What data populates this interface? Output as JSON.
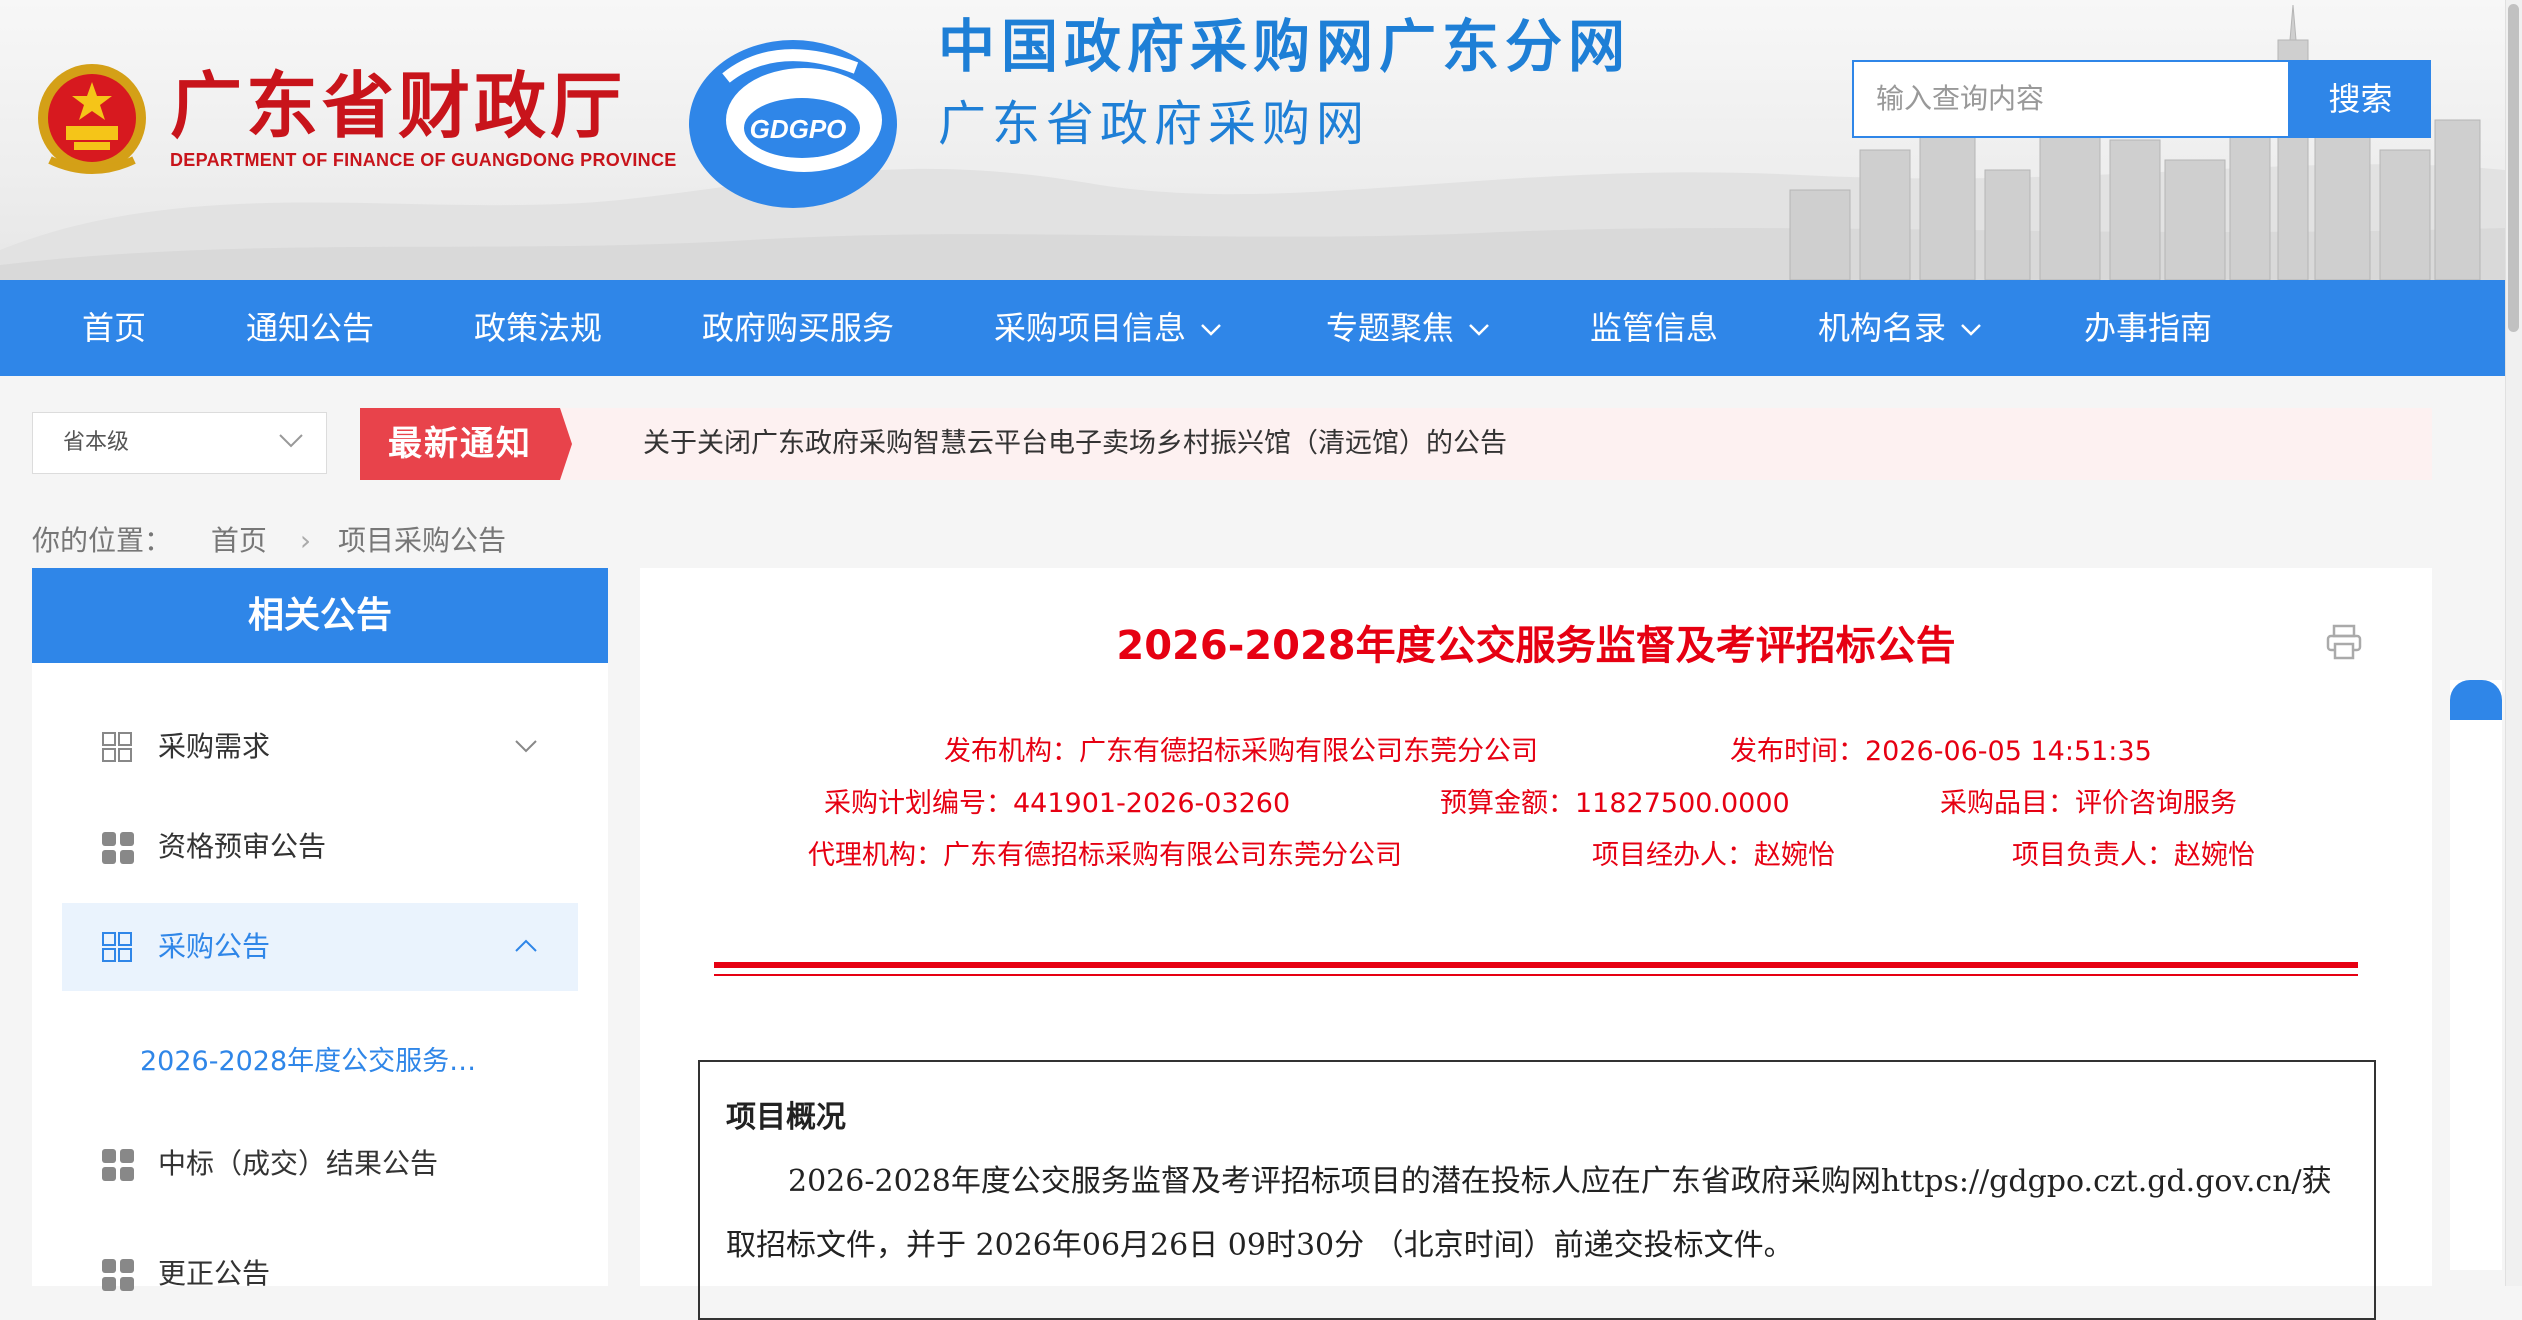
{
  "header": {
    "dept_cn": "广东省财政厅",
    "dept_en": "DEPARTMENT OF FINANCE OF GUANGDONG PROVINCE",
    "logo_text": "GDGPO",
    "site_title_1": "中国政府采购网广东分网",
    "site_title_2": "广东省政府采购网",
    "search_placeholder": "输入查询内容",
    "search_button": "搜索"
  },
  "nav": {
    "items": [
      {
        "label": "首页"
      },
      {
        "label": "通知公告"
      },
      {
        "label": "政策法规"
      },
      {
        "label": "政府购买服务"
      },
      {
        "label": "采购项目信息"
      },
      {
        "label": "专题聚焦"
      },
      {
        "label": "监管信息"
      },
      {
        "label": "机构名录"
      },
      {
        "label": "办事指南"
      }
    ]
  },
  "notice": {
    "level_select": "省本级",
    "tag": "最新通知",
    "text": "关于关闭广东政府采购智慧云平台电子卖场乡村振兴馆（清远馆）的公告"
  },
  "breadcrumb": {
    "prefix": "你的位置：",
    "home": "首页",
    "current": "项目采购公告"
  },
  "sidebar": {
    "title": "相关公告",
    "items": [
      {
        "label": "采购需求"
      },
      {
        "label": "资格预审公告"
      },
      {
        "label": "采购公告"
      },
      {
        "label": "中标（成交）结果公告"
      },
      {
        "label": "更正公告"
      }
    ],
    "active_sub": "2026-2028年度公交服务…"
  },
  "article": {
    "title": "2026-2028年度公交服务监督及考评招标公告",
    "publisher_label": "发布机构：",
    "publisher": "广东有德招标采购有限公司东莞分公司",
    "time_label": "发布时间：",
    "time": "2026-06-05 14:51:35",
    "plan_no_label": "采购计划编号：",
    "plan_no": "441901-2026-03260",
    "budget_label": "预算金额：",
    "budget": "11827500.0000",
    "category_label": "采购品目：",
    "category": "评价咨询服务",
    "agency_label": "代理机构：",
    "agency": "广东有德招标采购有限公司东莞分公司",
    "handler_label": "项目经办人：",
    "handler": "赵婉怡",
    "lead_label": "项目负责人：",
    "lead": "赵婉怡",
    "section_heading": "项目概况",
    "paragraph": "2026-2028年度公交服务监督及考评招标项目的潜在投标人应在广东省政府采购网https://gdgpo.czt.gd.gov.cn/获取招标文件，并于 2026年06月26日 09时30分 （北京时间）前递交投标文件。"
  },
  "colors": {
    "primary_blue": "#2f86e8",
    "title_red": "#e60012",
    "dept_red": "#c8141b"
  }
}
